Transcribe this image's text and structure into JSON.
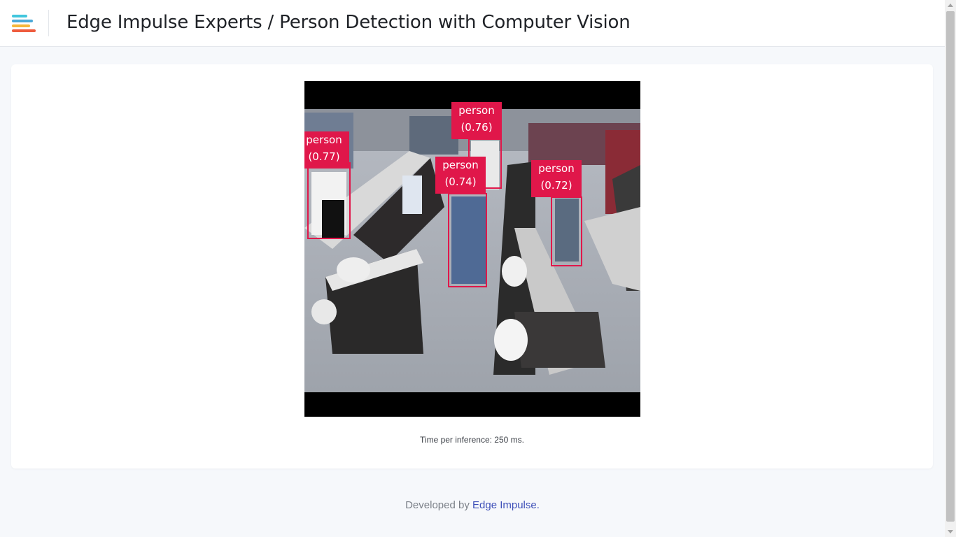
{
  "header": {
    "logo_icon": "edge-impulse-logo-icon",
    "title": "Edge Impulse Experts / Person Detection with Computer Vision"
  },
  "detections": [
    {
      "label": "person",
      "score": "(0.77)"
    },
    {
      "label": "person",
      "score": "(0.76)"
    },
    {
      "label": "person",
      "score": "(0.74)"
    },
    {
      "label": "person",
      "score": "(0.72)"
    }
  ],
  "inference": {
    "text": "Time per inference: 250 ms."
  },
  "footer": {
    "prefix": "Developed by ",
    "link_text": "Edge Impulse."
  },
  "colors": {
    "bbox": "#e0174a",
    "link": "#3d4fb8",
    "background": "#f6f8fb"
  }
}
